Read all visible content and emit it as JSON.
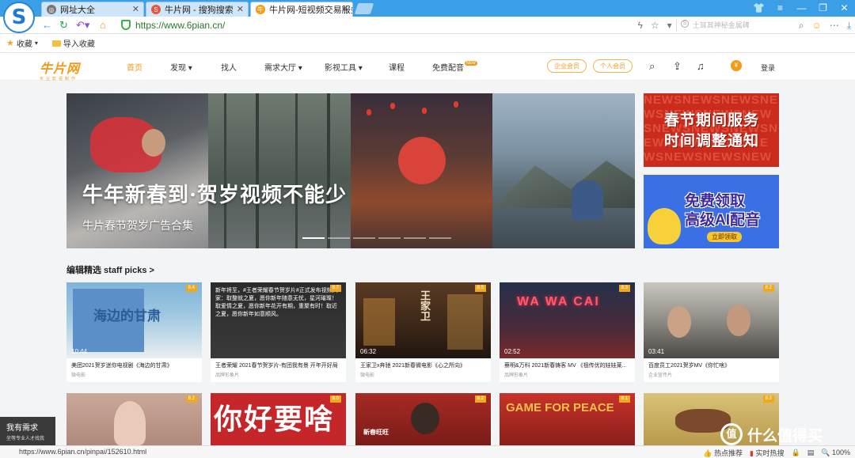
{
  "browser": {
    "tabs": [
      {
        "label": "网址大全",
        "icon": "globe-icon"
      },
      {
        "label": "牛片网 - 搜狗搜索",
        "icon": "sogou-icon"
      },
      {
        "label": "牛片网-短视频交易服务",
        "icon": "site-favicon"
      }
    ],
    "url": "https://www.6pian.cn/",
    "search_placeholder": "土耳其神秘金属碑",
    "favorites": [
      {
        "label": "收藏"
      },
      {
        "label": "导入收藏"
      }
    ],
    "colors": {
      "chrome": "#3a9fe6",
      "secure": "#3cb34a"
    }
  },
  "site": {
    "logo": "牛片网",
    "logo_sub": "专业影视制作",
    "nav": [
      {
        "label": "首页"
      },
      {
        "label": "发现"
      },
      {
        "label": "找人"
      },
      {
        "label": "需求大厅"
      },
      {
        "label": "影视工具"
      },
      {
        "label": "课程"
      },
      {
        "label": "免费配音"
      }
    ],
    "new_badge": "NEW",
    "enterprise_vip": "企业会员",
    "personal_vip": "个人会员",
    "login": "登录",
    "accent": "#f29a1a"
  },
  "banner": {
    "title": "牛年新春到·贺岁视频不能少",
    "subtitle": "牛片春节贺岁广告合集",
    "slide_count": 6,
    "active_slide": 1
  },
  "ads": [
    {
      "text": "春节期间服务时间调整通知",
      "line1": "春节期间服务",
      "line2": "时间调整通知",
      "bg_text": "NEWS"
    },
    {
      "line1": "免费领取",
      "line2": "高级AI配音",
      "button": "立即领取"
    }
  ],
  "staff_picks": {
    "title": "编辑精选 staff picks >",
    "cards": [
      {
        "title": "美团2021贺岁迷你电视剧《海边的甘肃》",
        "sub": "微电影",
        "rating": "8.4",
        "duration": "10:44",
        "overlay": "海边的甘肃"
      },
      {
        "title": "王者荣耀 2021春节贺岁片-有团我有景 开年开好局",
        "sub": "品牌形象片",
        "rating": "8.7",
        "duration": "",
        "overlay": "新年将至，#王者荣耀春节贺岁片#正式发布视频大家：取整就之夏，愿你新年随意无忧，星河璀璨！取爱情之夏，愿你新年花开有期，重聚有时！取近之夏，愿你新年如意顺风。"
      },
      {
        "title": "王家卫x奔驰 2021新春微电影《心之所向》",
        "sub": "微电影",
        "rating": "8.5",
        "duration": "06:32",
        "overlay": "王家卫"
      },
      {
        "title": "蔡明&万科 2021新春铸客 MV 《祖传优的娃娃莱...",
        "sub": "品牌形象片",
        "rating": "8.3",
        "duration": "02:52",
        "overlay": "WA WA CAI"
      },
      {
        "title": "百度员工2021贺岁MV《你忙啥》",
        "sub": "企业宣传片",
        "rating": "8.2",
        "duration": "03:41",
        "overlay": ""
      },
      {
        "title": "",
        "sub": "",
        "rating": "8.2",
        "duration": "",
        "overlay": ""
      },
      {
        "title": "",
        "sub": "",
        "rating": "8.0",
        "duration": "",
        "overlay": "你好要啥"
      },
      {
        "title": "",
        "sub": "",
        "rating": "8.2",
        "duration": "",
        "overlay": "新春旺旺"
      },
      {
        "title": "",
        "sub": "",
        "rating": "8.1",
        "duration": "",
        "overlay": "GAME FOR PEACE"
      },
      {
        "title": "",
        "sub": "",
        "rating": "8.2",
        "duration": "",
        "overlay": ""
      }
    ]
  },
  "demand_widget": {
    "title": "我有需求",
    "sub": "坐等专业人才找我"
  },
  "watermark": "什么值得买",
  "statusbar": {
    "url": "https://www.6pian.cn/pinpai/152610.html",
    "hot_recommend": "热点推荐",
    "realtime_hot": "实时热搜",
    "zoom": "100%"
  }
}
